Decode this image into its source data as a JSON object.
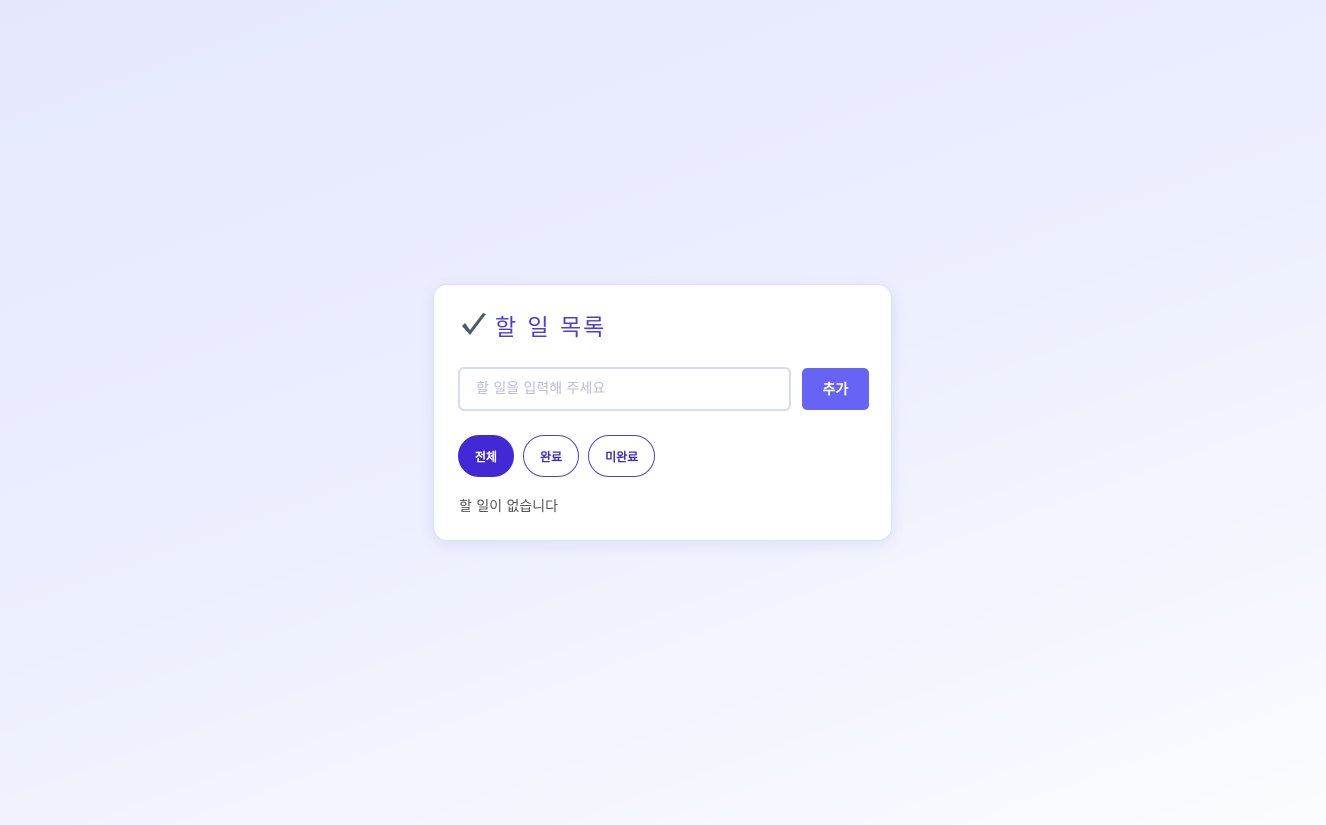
{
  "card": {
    "title": "할 일 목록",
    "title_icon": "check-icon"
  },
  "input": {
    "value": "",
    "placeholder": "할 일을 입력해 주세요"
  },
  "add_button": {
    "label": "추가"
  },
  "filters": [
    {
      "label": "전체",
      "active": true
    },
    {
      "label": "완료",
      "active": false
    },
    {
      "label": "미완료",
      "active": false
    }
  ],
  "empty_message": "할 일이 없습니다",
  "colors": {
    "accent": "#6663f5",
    "active_filter": "#4328d6",
    "title": "#4b3fd6"
  }
}
